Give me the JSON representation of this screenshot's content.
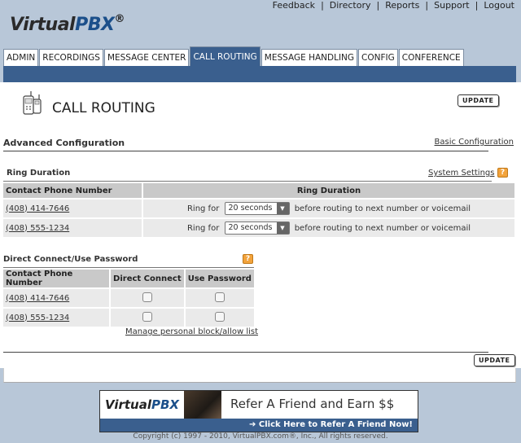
{
  "top_links": [
    "Feedback",
    "Directory",
    "Reports",
    "Support",
    "Logout"
  ],
  "logo": {
    "text_main": "Virtual",
    "text_brand": "PBX",
    "reg": "®"
  },
  "tabs": [
    {
      "label": "ADMIN",
      "active": false
    },
    {
      "label": "RECORDINGS",
      "active": false
    },
    {
      "label": "MESSAGE CENTER",
      "active": false
    },
    {
      "label": "CALL ROUTING",
      "active": true
    },
    {
      "label": "MESSAGE HANDLING",
      "active": false
    },
    {
      "label": "CONFIG",
      "active": false
    },
    {
      "label": "CONFERENCE",
      "active": false
    }
  ],
  "page": {
    "title": "CALL ROUTING",
    "update_label": "UPDATE",
    "advanced_label": "Advanced Configuration",
    "basic_link": "Basic Configuration"
  },
  "ring": {
    "title": "Ring Duration",
    "system_settings": "System Settings",
    "help": "?",
    "headers": [
      "Contact Phone Number",
      "Ring Duration"
    ],
    "ring_for": "Ring for",
    "after": "before routing to next number or voicemail",
    "rows": [
      {
        "phone": "(408) 414-7646",
        "duration": "20 seconds"
      },
      {
        "phone": "(408) 555-1234",
        "duration": "20 seconds"
      }
    ]
  },
  "direct": {
    "title": "Direct Connect/Use Password",
    "help": "?",
    "headers": [
      "Contact Phone Number",
      "Direct Connect",
      "Use Password"
    ],
    "rows": [
      {
        "phone": "(408) 414-7646",
        "direct_connect": false,
        "use_password": false
      },
      {
        "phone": "(408) 555-1234",
        "direct_connect": false,
        "use_password": false
      }
    ],
    "manage_link": "Manage personal block/allow list"
  },
  "banner": {
    "logo_main": "Virtual",
    "logo_brand": "PBX",
    "tagline": "Refer A Friend and Earn $$",
    "cta": "➔ Click Here to Refer A Friend Now!"
  },
  "copyright": "Copyright (c) 1997 - 2010, VirtualPBX.com®, Inc., All rights reserved."
}
